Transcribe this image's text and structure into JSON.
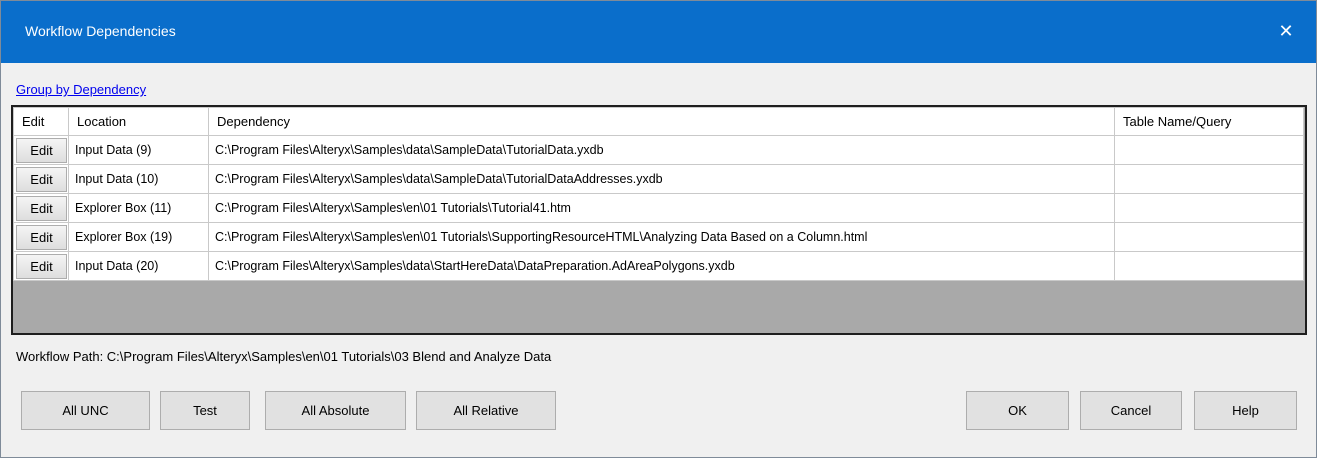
{
  "window": {
    "title": "Workflow Dependencies",
    "close_glyph": "✕"
  },
  "group_link": "Group by Dependency",
  "table": {
    "headers": [
      "Edit",
      "Location",
      "Dependency",
      "Table Name/Query"
    ],
    "rows": [
      {
        "edit": "Edit",
        "location": "Input Data (9)",
        "dependency": "C:\\Program Files\\Alteryx\\Samples\\data\\SampleData\\TutorialData.yxdb",
        "table_query": ""
      },
      {
        "edit": "Edit",
        "location": "Input Data (10)",
        "dependency": "C:\\Program Files\\Alteryx\\Samples\\data\\SampleData\\TutorialDataAddresses.yxdb",
        "table_query": ""
      },
      {
        "edit": "Edit",
        "location": "Explorer Box (11)",
        "dependency": "C:\\Program Files\\Alteryx\\Samples\\en\\01 Tutorials\\Tutorial41.htm",
        "table_query": ""
      },
      {
        "edit": "Edit",
        "location": "Explorer Box (19)",
        "dependency": "C:\\Program Files\\Alteryx\\Samples\\en\\01 Tutorials\\SupportingResourceHTML\\Analyzing Data Based on a Column.html",
        "table_query": ""
      },
      {
        "edit": "Edit",
        "location": "Input Data (20)",
        "dependency": "C:\\Program Files\\Alteryx\\Samples\\data\\StartHereData\\DataPreparation.AdAreaPolygons.yxdb",
        "table_query": ""
      }
    ]
  },
  "workflow_path": "Workflow Path: C:\\Program Files\\Alteryx\\Samples\\en\\01 Tutorials\\03 Blend and Analyze Data",
  "buttons": {
    "all_unc": "All UNC",
    "test": "Test",
    "all_absolute": "All Absolute",
    "all_relative": "All Relative",
    "ok": "OK",
    "cancel": "Cancel",
    "help": "Help"
  },
  "colors": {
    "titlebar": "#0a6ecb",
    "link": "#0000ee",
    "grid_background": "#a9a9a9"
  }
}
